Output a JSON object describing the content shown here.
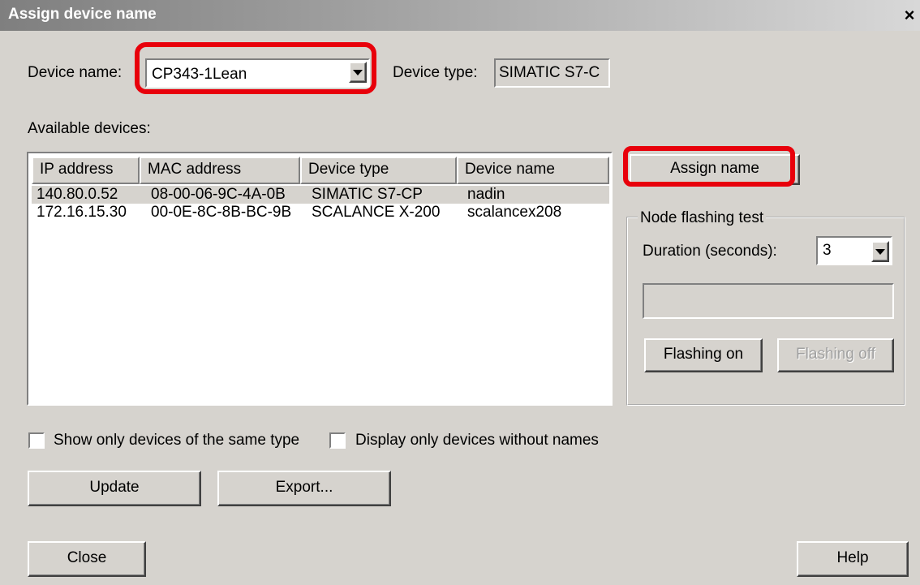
{
  "window": {
    "title": "Assign device name",
    "close_glyph": "×"
  },
  "device_name": {
    "label": "Device name:",
    "value": "CP343-1Lean"
  },
  "device_type": {
    "label": "Device type:",
    "value": "SIMATIC S7-C"
  },
  "available_devices": {
    "label": "Available devices:",
    "columns": [
      "IP address",
      "MAC address",
      "Device type",
      "Device name"
    ],
    "rows": [
      {
        "ip": "140.80.0.52",
        "mac": "08-00-06-9C-4A-0B",
        "type": "SIMATIC S7-CP",
        "name": "nadin",
        "selected": true
      },
      {
        "ip": "172.16.15.30",
        "mac": "00-0E-8C-8B-BC-9B",
        "type": "SCALANCE X-200",
        "name": "scalancex208",
        "selected": false
      }
    ]
  },
  "buttons": {
    "assign_name": "Assign name",
    "flashing_on": "Flashing on",
    "flashing_off": "Flashing off",
    "update": "Update",
    "export": "Export...",
    "close": "Close",
    "help": "Help"
  },
  "node_flashing": {
    "group_label": "Node flashing test",
    "duration_label": "Duration (seconds):",
    "duration_value": "3"
  },
  "filters": {
    "same_type_label": "Show only devices of the same type",
    "same_type_checked": false,
    "without_names_label": "Display only devices without names",
    "without_names_checked": false
  },
  "colors": {
    "highlight": "#e8000b",
    "face": "#d6d3ce",
    "selection": "#d6d3ce"
  },
  "icons": {
    "close": "close-icon",
    "dropdown": "chevron-down-icon"
  }
}
